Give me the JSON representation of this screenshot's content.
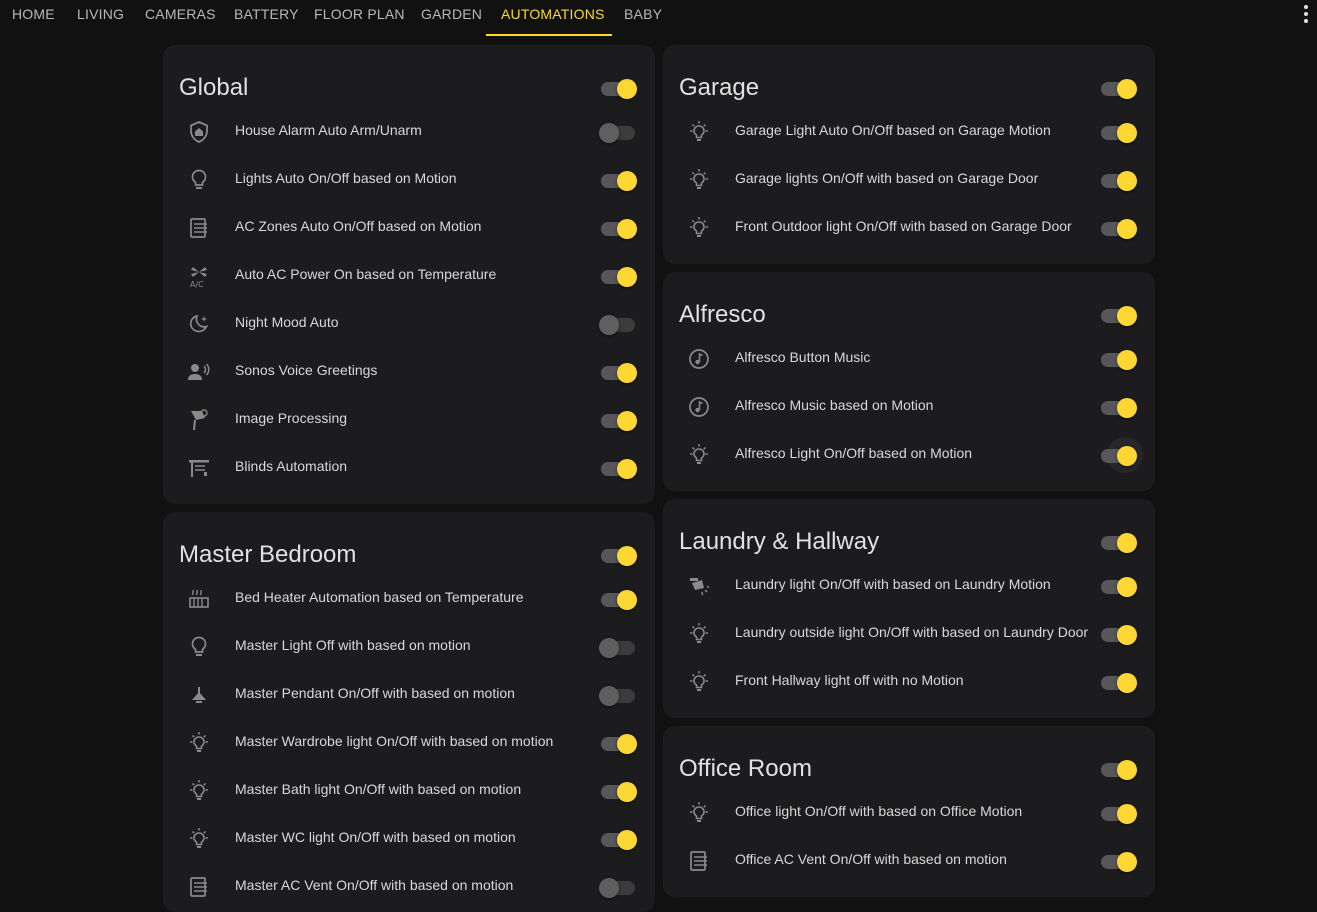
{
  "tabs": [
    "HOME",
    "LIVING",
    "CAMERAS",
    "BATTERY",
    "FLOOR PLAN",
    "GARDEN",
    "AUTOMATIONS",
    "BABY"
  ],
  "active_tab": "AUTOMATIONS",
  "cards": {
    "global": {
      "title": "Global",
      "on": true,
      "items": [
        {
          "label": "House Alarm Auto Arm/Unarm",
          "icon": "shield-home-icon",
          "on": false
        },
        {
          "label": "Lights Auto On/Off based on Motion",
          "icon": "lightbulb-icon",
          "on": true
        },
        {
          "label": "AC Zones Auto On/Off based on Motion",
          "icon": "air-filter-icon",
          "on": true
        },
        {
          "label": "Auto AC Power On based on Temperature",
          "icon": "air-conditioner-icon",
          "on": true
        },
        {
          "label": "Night Mood Auto",
          "icon": "moon-star-icon",
          "on": false
        },
        {
          "label": "Sonos Voice Greetings",
          "icon": "account-voice-icon",
          "on": true
        },
        {
          "label": "Image Processing",
          "icon": "cctv-icon",
          "on": true
        },
        {
          "label": "Blinds Automation",
          "icon": "blinds-icon",
          "on": true
        }
      ]
    },
    "master_bedroom": {
      "title": "Master Bedroom",
      "on": true,
      "items": [
        {
          "label": "Bed Heater Automation based on Temperature",
          "icon": "radiator-icon",
          "on": true
        },
        {
          "label": "Master Light Off with based on motion",
          "icon": "lightbulb-icon",
          "on": false
        },
        {
          "label": "Master Pendant On/Off with based on motion",
          "icon": "ceiling-light-icon",
          "on": false
        },
        {
          "label": "Master Wardrobe light On/Off with based on motion",
          "icon": "lightbulb-on-icon",
          "on": true
        },
        {
          "label": "Master Bath light On/Off with based on motion",
          "icon": "lightbulb-on-icon",
          "on": true
        },
        {
          "label": "Master WC light On/Off with based on motion",
          "icon": "lightbulb-on-icon",
          "on": true
        },
        {
          "label": "Master AC Vent On/Off with based on motion",
          "icon": "air-filter-icon",
          "on": false
        }
      ]
    },
    "garage": {
      "title": "Garage",
      "on": true,
      "items": [
        {
          "label": "Garage Light Auto On/Off based on Garage Motion",
          "icon": "lightbulb-on-icon",
          "on": true
        },
        {
          "label": "Garage lights On/Off with based on Garage Door",
          "icon": "lightbulb-on-icon",
          "on": true
        },
        {
          "label": "Front Outdoor light On/Off with based on Garage Door",
          "icon": "lightbulb-on-icon",
          "on": true
        }
      ]
    },
    "alfresco": {
      "title": "Alfresco",
      "on": true,
      "items": [
        {
          "label": "Alfresco Button Music",
          "icon": "music-circle-icon",
          "on": true
        },
        {
          "label": "Alfresco Music based on Motion",
          "icon": "music-circle-icon",
          "on": true
        },
        {
          "label": "Alfresco Light On/Off based on Motion",
          "icon": "lightbulb-on-icon",
          "on": true
        }
      ]
    },
    "laundry": {
      "title": "Laundry & Hallway",
      "on": true,
      "items": [
        {
          "label": "Laundry light On/Off with based on Laundry Motion",
          "icon": "track-light-icon",
          "on": true
        },
        {
          "label": "Laundry outside light On/Off with based on Laundry Door",
          "icon": "lightbulb-on-icon",
          "on": true
        },
        {
          "label": "Front Hallway light off with no Motion",
          "icon": "lightbulb-on-icon",
          "on": true
        }
      ]
    },
    "office": {
      "title": "Office Room",
      "on": true,
      "items": [
        {
          "label": "Office light On/Off with based on Office Motion",
          "icon": "lightbulb-on-icon",
          "on": true
        },
        {
          "label": "Office AC Vent On/Off with based on motion",
          "icon": "air-filter-icon",
          "on": true
        }
      ]
    }
  },
  "colors": {
    "accent": "#fdd835",
    "background": "#111111",
    "card": "#1c1c1e"
  }
}
